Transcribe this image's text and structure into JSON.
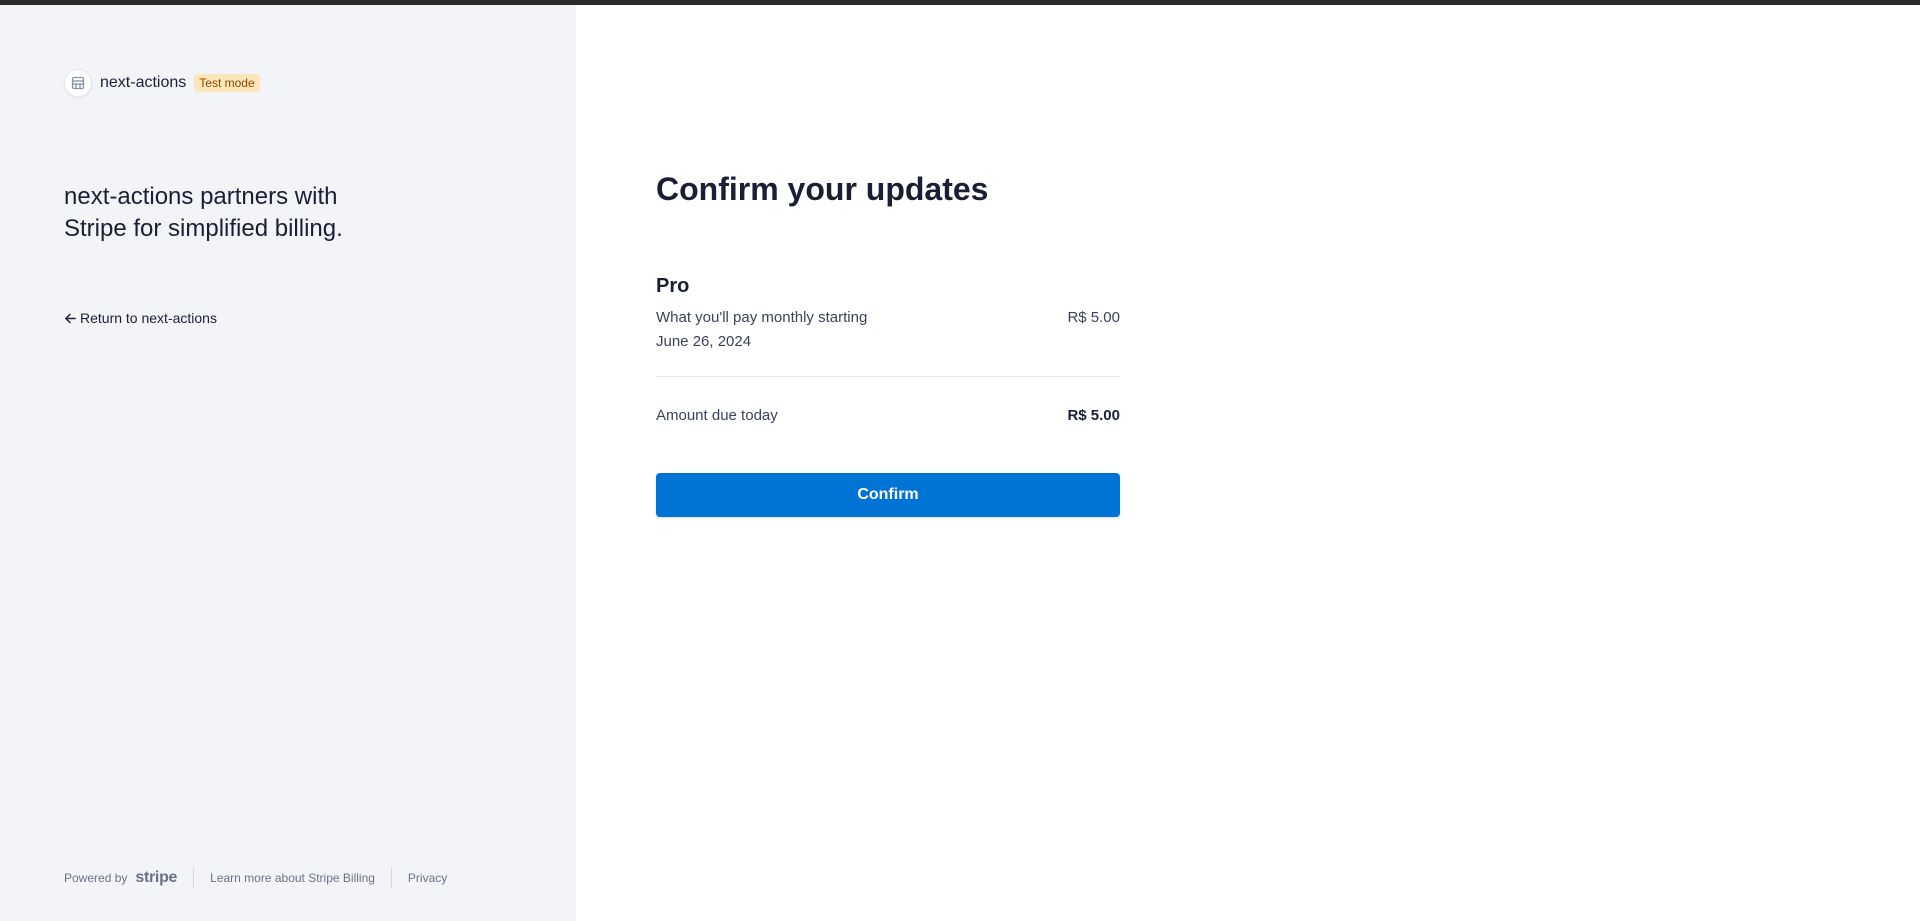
{
  "left": {
    "brand_icon": "storefront-icon",
    "brand_name": "next-actions",
    "badge": "Test mode",
    "tagline": "next-actions partners with Stripe for simplified billing.",
    "return_icon": "arrow-left-icon",
    "return_label": "Return to next-actions",
    "footer": {
      "powered_by": "Powered by",
      "stripe_logo": "stripe",
      "learn_more": "Learn more about Stripe Billing",
      "privacy": "Privacy"
    }
  },
  "main": {
    "title": "Confirm your updates",
    "plan": {
      "name": "Pro",
      "description": "What you'll pay monthly starting June 26, 2024",
      "price": "R$ 5.00"
    },
    "due": {
      "label": "Amount due today",
      "amount": "R$ 5.00"
    },
    "confirm_label": "Confirm"
  },
  "colors": {
    "accent": "#0074d4",
    "left_panel_bg": "#f3f4f8",
    "badge_bg": "#fde6b8",
    "badge_text": "#8a4a00"
  }
}
